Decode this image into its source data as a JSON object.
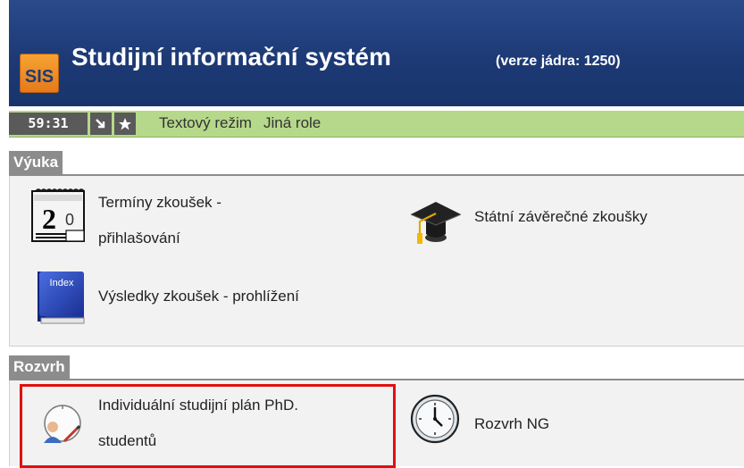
{
  "header": {
    "logo_text": "SIS",
    "title": "Studijní informační systém",
    "version": "(verze jádra: 1250)"
  },
  "toolbar": {
    "timer": "59:31",
    "links": [
      "Textový režim",
      "Jiná role"
    ]
  },
  "sections": [
    {
      "label": "Výuka",
      "items": [
        {
          "line1": "Termíny zkoušek -",
          "line2": "přihlašování",
          "icon": "calendar-20-icon"
        },
        {
          "line1": "Státní závěrečné zkoušky",
          "icon": "graduation-cap-icon"
        },
        {
          "line1": "Výsledky zkoušek - prohlížení",
          "icon": "index-book-icon",
          "icon_text": "Index"
        }
      ]
    },
    {
      "label": "Rozvrh",
      "items": [
        {
          "line1": "Individuální studijní plán PhD.",
          "line2": "studentů",
          "icon": "person-plan-icon"
        },
        {
          "line1": "Rozvrh NG",
          "icon": "clock-icon"
        }
      ]
    }
  ],
  "colors": {
    "header": "#1d3a76",
    "toolbar": "#b6d88a",
    "highlight": "#e01010"
  }
}
